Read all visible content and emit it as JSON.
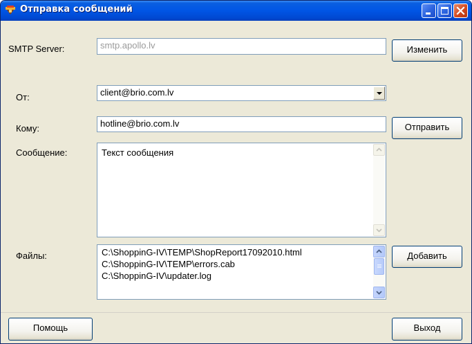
{
  "window": {
    "title": "Отправка сообщений",
    "icon": "mail-app-icon",
    "controls": [
      "minimize-icon",
      "maximize-icon",
      "close-icon"
    ]
  },
  "smtp": {
    "label": "SMTP Server:",
    "value": "smtp.apollo.lv",
    "button": "Изменить"
  },
  "from": {
    "label": "От:",
    "value": "client@brio.com.lv"
  },
  "to": {
    "label": "Кому:",
    "value": "hotline@brio.com.lv",
    "button": "Отправить"
  },
  "message": {
    "label": "Сообщение:",
    "value": "Текст сообщения"
  },
  "files": {
    "label": "Файлы:",
    "items": [
      "C:\\ShoppinG-IV\\TEMP\\ShopReport17092010.html",
      "C:\\ShoppinG-IV\\TEMP\\errors.cab",
      "C:\\ShoppinG-IV\\updater.log"
    ],
    "button": "Добавить"
  },
  "footer": {
    "help": "Помощь",
    "exit": "Выход"
  },
  "colors": {
    "titlebar": "#0055e5",
    "window_bg": "#ece9d8",
    "field_border": "#7f9db9"
  }
}
